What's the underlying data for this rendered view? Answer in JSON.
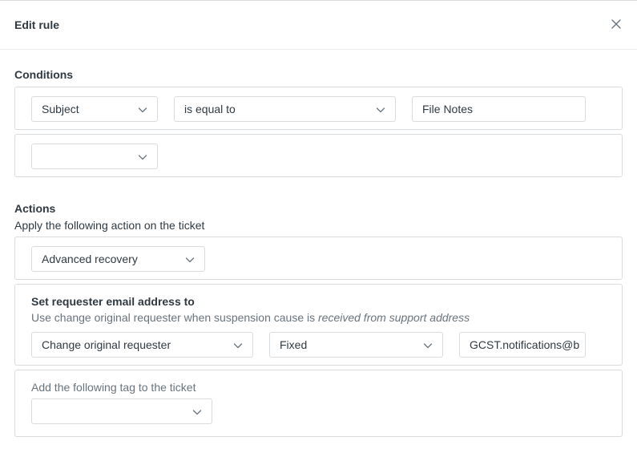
{
  "modal": {
    "title": "Edit rule"
  },
  "conditions": {
    "title": "Conditions",
    "rows": [
      {
        "field": "Subject",
        "operator": "is equal to",
        "value": "File Notes"
      },
      {
        "field": ""
      }
    ]
  },
  "actions": {
    "title": "Actions",
    "subtitle": "Apply the following action on the ticket",
    "action_type": "Advanced recovery",
    "requester": {
      "title": "Set requester email address to",
      "hint_prefix": "Use change original requester when suspension cause is ",
      "hint_emphasis": "received from support address",
      "mode": "Change original requester",
      "type": "Fixed",
      "email": "GCST.notifications@b"
    },
    "tag": {
      "label": "Add the following tag to the ticket",
      "value": ""
    }
  },
  "icons": {
    "close": "close-icon",
    "chevron": "chevron-down-icon"
  },
  "colors": {
    "text": "#2f3941",
    "muted": "#68737d",
    "border": "#d8dcde"
  }
}
